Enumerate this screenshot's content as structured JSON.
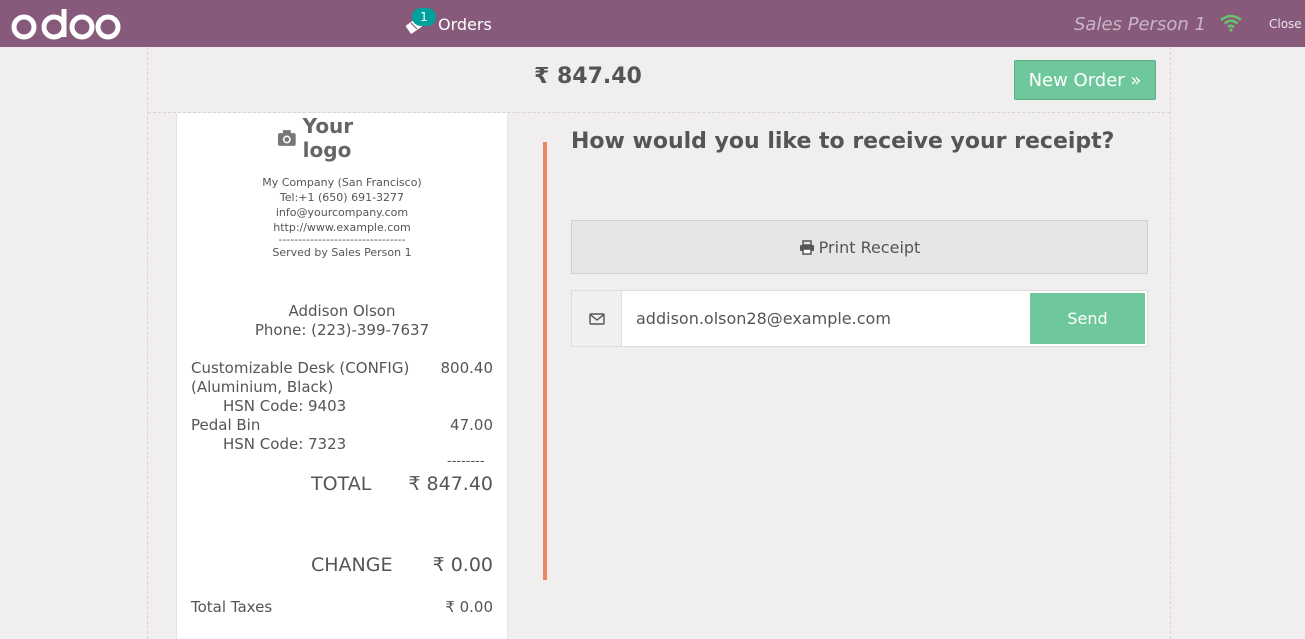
{
  "header": {
    "brand": "odoo",
    "orders_label": "Orders",
    "orders_count": "1",
    "salesperson": "Sales Person 1",
    "close_label": "Close",
    "colors": {
      "bar": "#875a7b",
      "badge": "#00a09d",
      "wifi": "#6ac26a"
    }
  },
  "summary": {
    "total": "₹ 847.40",
    "new_order_label": "New Order »"
  },
  "receipt": {
    "logo_text": "Your logo",
    "company_lines": [
      "My Company (San Francisco)",
      "Tel:+1 (650) 691-3277",
      "info@yourcompany.com",
      "http://www.example.com",
      "--------------------------------",
      "Served by Sales Person 1"
    ],
    "customer_name": "Addison Olson",
    "customer_phone": "Phone: (223)-399-7637",
    "lines": [
      {
        "name": "Customizable Desk (CONFIG) (Aluminium, Black)",
        "price": "800.40",
        "hsn": "HSN Code: 9403"
      },
      {
        "name": "Pedal Bin",
        "price": "47.00",
        "hsn": "HSN Code: 7323"
      }
    ],
    "dashes": "--------",
    "total_label": "TOTAL",
    "total_value": "₹ 847.40",
    "change_label": "CHANGE",
    "change_value": "₹ 0.00",
    "taxes_label": "Total Taxes",
    "taxes_value": "₹ 0.00"
  },
  "panel": {
    "question": "How would you like to receive your receipt?",
    "print_label": "Print Receipt",
    "email_value": "addison.olson28@example.com",
    "send_label": "Send",
    "accent_color": "#e8875f",
    "send_color": "#6ec89b"
  }
}
